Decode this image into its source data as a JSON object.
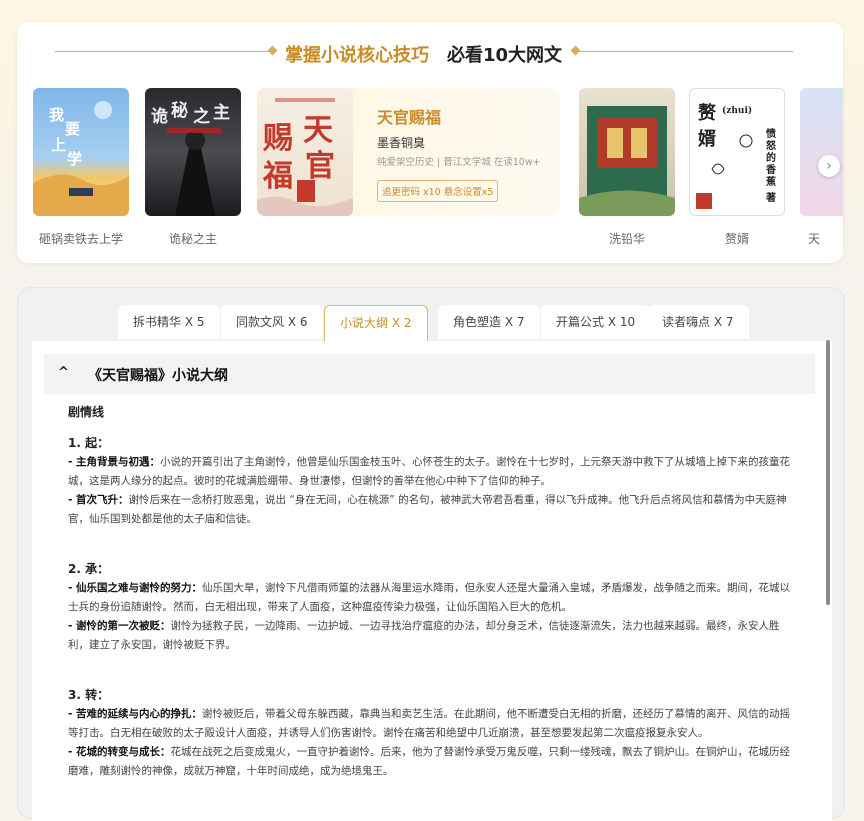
{
  "header": {
    "title_highlight": "掌握小说核心技巧",
    "title_rest": "必看10大网文"
  },
  "books": [
    {
      "name": "砸锅卖铁去上学",
      "cover_text": "我要上学"
    },
    {
      "name": "诡秘之主",
      "cover_text": "诡秘之主"
    },
    {
      "name": "洗铅华",
      "cover_text": ""
    },
    {
      "name": "赘婿",
      "cover_text": "赘婿 (zhui) 愤怒的香蕉 著"
    },
    {
      "name": "天",
      "cover_text": ""
    }
  ],
  "featured": {
    "title": "天官赐福",
    "author": "墨香铜臭",
    "meta": "纯爱架空历史 | 晋江文学城 在读10w+",
    "tag": "追更密码 x10 悬念设置x5",
    "cover_text": "天官赐福"
  },
  "next_label": "›",
  "tabs": [
    {
      "label": "拆书精华 X 5"
    },
    {
      "label": "同款文风 X 6"
    },
    {
      "label": "小说大纲 X 2"
    },
    {
      "label": "角色塑造 X 7"
    },
    {
      "label": "开篇公式 X 10"
    },
    {
      "label": "读者嗨点 X 7"
    }
  ],
  "active_tab": "小说大纲 X 2",
  "outline": {
    "caret": "^",
    "title": "《天官赐福》小说大纲",
    "section_label": "剧情线",
    "stages": [
      {
        "heading": "1. 起：",
        "items": [
          {
            "lead": "- 主角背景与初遇：",
            "text": "小说的开篇引出了主角谢怜，他曾是仙乐国金枝玉叶、心怀苍生的太子。谢怜在十七岁时，上元祭天游中救下了从城墙上掉下来的孩童花城，这是两人缘分的起点。彼时的花城满脸绷带、身世凄惨，但谢怜的善举在他心中种下了信仰的种子。"
          },
          {
            "lead": "- 首次飞升：",
            "text": "谢怜后来在一念桥打败恶鬼，说出 “身在无间，心在桃源” 的名句，被神武大帝君吾看重，得以飞升成神。他飞升后点将风信和慕情为中天庭神官，仙乐国到处都是他的太子庙和信徒。"
          }
        ]
      },
      {
        "heading": "2. 承：",
        "items": [
          {
            "lead": "- 仙乐国之难与谢怜的努力：",
            "text": "仙乐国大旱，谢怜下凡借雨师篁的法器从海里运水降雨，但永安人还是大量涌入皇城，矛盾爆发，战争随之而来。期间，花城以士兵的身份追随谢怜。然而，白无相出现，带来了人面疫，这种瘟疫传染力极强，让仙乐国陷入巨大的危机。"
          },
          {
            "lead": "- 谢怜的第一次被贬：",
            "text": "谢怜为拯救子民，一边降雨、一边护城、一边寻找治疗瘟疫的办法，却分身乏术，信徒逐渐流失，法力也越来越弱。最终，永安人胜利，建立了永安国，谢怜被贬下界。"
          }
        ]
      },
      {
        "heading": "3. 转：",
        "items": [
          {
            "lead": "- 苦难的延续与内心的挣扎：",
            "text": "谢怜被贬后，带着父母东躲西藏，靠典当和卖艺生活。在此期间，他不断遭受白无相的折磨，还经历了慕情的离开、风信的动摇等打击。白无相在破败的太子殿设计人面疫，并诱导人们伤害谢怜。谢怜在痛苦和绝望中几近崩溃，甚至想要发起第二次瘟疫报复永安人。"
          },
          {
            "lead": "- 花城的转变与成长：",
            "text": "花城在战死之后变成鬼火，一直守护着谢怜。后来，他为了替谢怜承受万鬼反噬，只剩一缕残魂，飘去了铜炉山。在铜炉山，花城历经磨难，雕刻谢怜的神像，成就万神窟，十年时间成绝，成为绝境鬼王。"
          }
        ]
      }
    ]
  },
  "colors": {
    "accent": "#c98c26",
    "accent_border": "#e3b66d",
    "page_bg": "#f7f4ee"
  }
}
